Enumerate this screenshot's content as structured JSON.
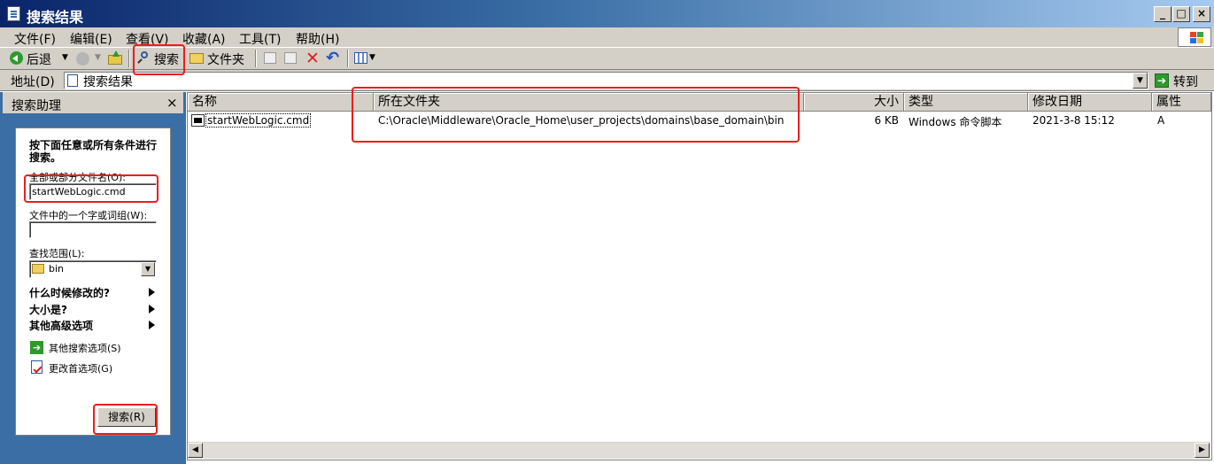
{
  "window": {
    "title": "搜索结果",
    "min": "_",
    "max": "□",
    "close": "×"
  },
  "menu": [
    "文件(F)",
    "编辑(E)",
    "查看(V)",
    "收藏(A)",
    "工具(T)",
    "帮助(H)"
  ],
  "toolbar": {
    "back": "后退",
    "search": "搜索",
    "folders": "文件夹"
  },
  "address": {
    "label": "地址(D)",
    "value": "搜索结果",
    "go": "转到"
  },
  "assistant": {
    "title": "搜索助理",
    "close": "×",
    "intro": "按下面任意或所有条件进行搜索。",
    "filename_label": "全部或部分文件名(O):",
    "filename_value": "startWebLogic.cmd",
    "word_label": "文件中的一个字或词组(W):",
    "word_value": "",
    "lookin_label": "查找范围(L):",
    "lookin_value": "bin",
    "when_modified": "什么时候修改的?",
    "size": "大小是?",
    "advanced": "其他高级选项",
    "other_options": "其他搜索选项(S)",
    "change_prefs": "更改首选项(G)",
    "search_button": "搜索(R)"
  },
  "columns": {
    "name": "名称",
    "folder": "所在文件夹",
    "size": "大小",
    "type": "类型",
    "modified": "修改日期",
    "attr": "属性"
  },
  "results": [
    {
      "name": "startWebLogic.cmd",
      "folder": "C:\\Oracle\\Middleware\\Oracle_Home\\user_projects\\domains\\base_domain\\bin",
      "size": "6 KB",
      "type": "Windows 命令脚本",
      "modified": "2021-3-8 15:12",
      "attr": "A"
    }
  ],
  "colors": {
    "title_dark": "#0a246a",
    "chrome": "#d4d0c8",
    "assist_bg": "#3a6ea5",
    "highlight": "#ee1c1c"
  }
}
